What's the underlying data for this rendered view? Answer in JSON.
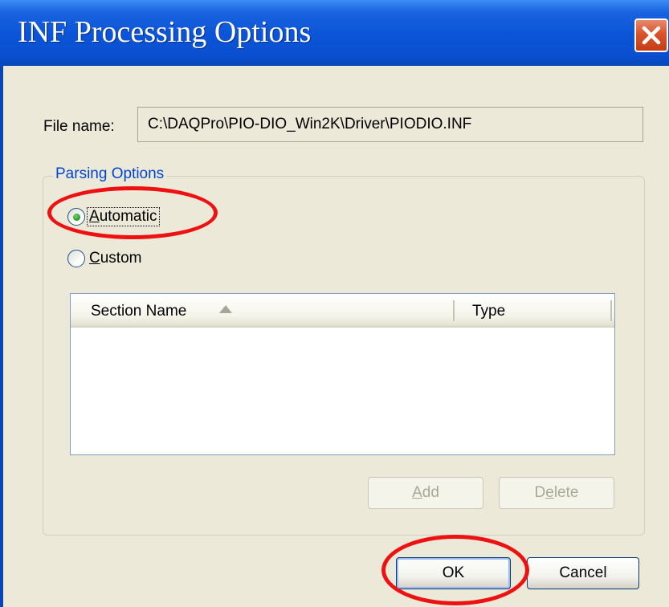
{
  "window": {
    "title": "INF Processing Options",
    "close_icon": "close-x-icon"
  },
  "file": {
    "label": "File name:",
    "value": "C:\\DAQPro\\PIO-DIO_Win2K\\Driver\\PIODIO.INF"
  },
  "parsing": {
    "group_label": "Parsing Options",
    "options": [
      {
        "label_mnemonic": "A",
        "label_rest": "utomatic",
        "label": "Automatic",
        "selected": true
      },
      {
        "label_mnemonic": "C",
        "label_rest": "ustom",
        "label": "Custom",
        "selected": false
      }
    ]
  },
  "list": {
    "columns": [
      "Section Name",
      "Type"
    ],
    "sort_icon": "sort-ascending-icon",
    "rows": []
  },
  "buttons": {
    "add": {
      "mnemonic": "A",
      "rest": "dd",
      "label": "Add",
      "enabled": false
    },
    "delete": {
      "pre": "D",
      "mnemonic": "e",
      "rest": "lete",
      "label": "Delete",
      "enabled": false
    },
    "ok": "OK",
    "cancel": "Cancel"
  },
  "annotations": {
    "highlight_color": "#ee1111",
    "highlighted": [
      "Automatic",
      "OK"
    ]
  },
  "colors": {
    "titlebar": "#0a4fd0",
    "dialog_bg": "#ece9d8",
    "group_label": "#0046d5",
    "close_button": "#d9532c"
  }
}
